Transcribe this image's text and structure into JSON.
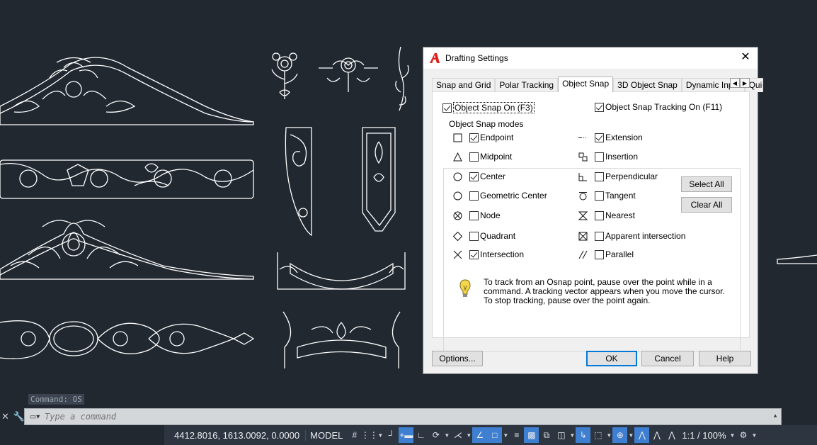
{
  "command": {
    "history": "Command: OS",
    "placeholder": "Type a command"
  },
  "status_bar": {
    "coordinates": "4412.8016, 1613.0092, 0.0000",
    "model_label": "MODEL",
    "scale": "1:1 / 100%"
  },
  "dialog": {
    "title": "Drafting Settings",
    "tabs": [
      "Snap and Grid",
      "Polar Tracking",
      "Object Snap",
      "3D Object Snap",
      "Dynamic Input",
      "Quic"
    ],
    "active_tab": "Object Snap",
    "osnap_on_label": "Object Snap On (F3)",
    "osnap_tracking_label": "Object Snap Tracking On (F11)",
    "modes_group_label": "Object Snap modes",
    "left_modes": [
      {
        "label": "Endpoint",
        "checked": true,
        "icon": "square-marker"
      },
      {
        "label": "Midpoint",
        "checked": false,
        "icon": "triangle-marker"
      },
      {
        "label": "Center",
        "checked": true,
        "icon": "circle-marker"
      },
      {
        "label": "Geometric Center",
        "checked": false,
        "icon": "circle-marker"
      },
      {
        "label": "Node",
        "checked": false,
        "icon": "node-marker"
      },
      {
        "label": "Quadrant",
        "checked": false,
        "icon": "diamond-marker"
      },
      {
        "label": "Intersection",
        "checked": true,
        "icon": "x-marker"
      }
    ],
    "right_modes": [
      {
        "label": "Extension",
        "checked": true,
        "icon": "extension-marker"
      },
      {
        "label": "Insertion",
        "checked": false,
        "icon": "insertion-marker"
      },
      {
        "label": "Perpendicular",
        "checked": false,
        "icon": "perpendicular-marker"
      },
      {
        "label": "Tangent",
        "checked": false,
        "icon": "tangent-marker"
      },
      {
        "label": "Nearest",
        "checked": false,
        "icon": "nearest-marker"
      },
      {
        "label": "Apparent intersection",
        "checked": false,
        "icon": "apparent-intersection-marker"
      },
      {
        "label": "Parallel",
        "checked": false,
        "icon": "parallel-marker"
      }
    ],
    "select_all_label": "Select All",
    "clear_all_label": "Clear All",
    "info_text": "To track from an Osnap point, pause over the point while in a command.  A tracking vector appears when you move the cursor.  To stop tracking, pause over the point again.",
    "options_label": "Options...",
    "ok_label": "OK",
    "cancel_label": "Cancel",
    "help_label": "Help"
  },
  "colors": {
    "canvas": "#212830",
    "accent": "#0078d7",
    "status_on": "#3f7fd1",
    "logo_red": "#e0211b"
  }
}
